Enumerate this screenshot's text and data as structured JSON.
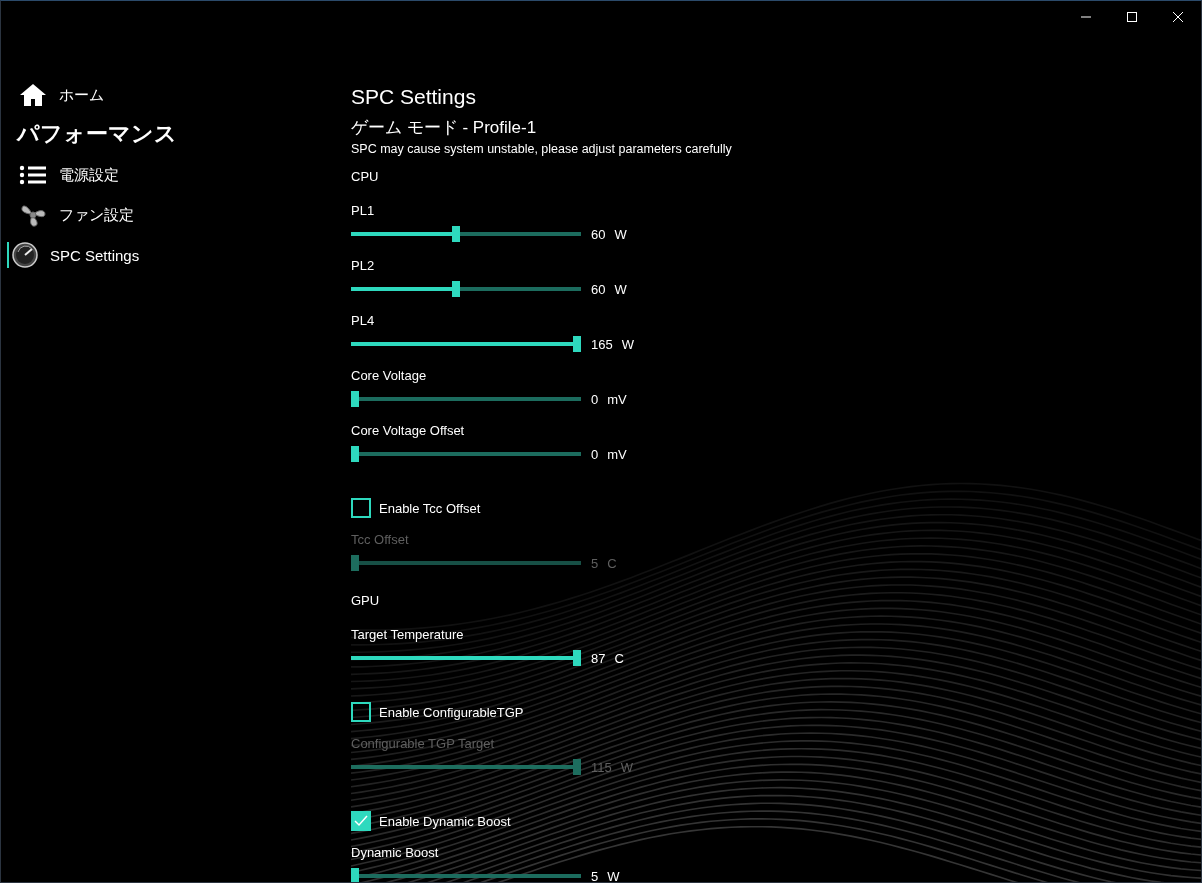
{
  "sidebar": {
    "items": [
      {
        "kind": "home",
        "label": "ホーム",
        "selected": false
      },
      {
        "kind": "header",
        "label": "パフォーマンス"
      },
      {
        "kind": "list",
        "label": "電源設定",
        "selected": false
      },
      {
        "kind": "fan",
        "label": "ファン設定",
        "selected": false
      },
      {
        "kind": "gauge",
        "label": "SPC Settings",
        "selected": true
      }
    ]
  },
  "page": {
    "title": "SPC Settings",
    "subtitle": "ゲーム モード - Profile-1",
    "warning": "SPC may cause system unstable, please adjust parameters carefully",
    "controls": [
      {
        "kind": "heading",
        "label": "CPU"
      },
      {
        "kind": "slider",
        "label": "PL1",
        "level": 0.455,
        "value": "60",
        "unit": "W",
        "disabled": false
      },
      {
        "kind": "slider",
        "label": "PL2",
        "level": 0.455,
        "value": "60",
        "unit": "W",
        "disabled": false
      },
      {
        "kind": "slider",
        "label": "PL4",
        "level": 1,
        "value": "165",
        "unit": "W",
        "disabled": false
      },
      {
        "kind": "slider",
        "label": "Core Voltage",
        "level": 0,
        "value": "0",
        "unit": "mV",
        "disabled": false
      },
      {
        "kind": "slider",
        "label": "Core Voltage Offset",
        "level": 0,
        "value": "0",
        "unit": "mV",
        "disabled": false
      },
      {
        "kind": "checkbox",
        "label": "Enable Tcc Offset",
        "checked": false
      },
      {
        "kind": "slider",
        "label": "Tcc Offset",
        "level": 0,
        "value": "5",
        "unit": "C",
        "disabled": true
      },
      {
        "kind": "heading",
        "label": "GPU"
      },
      {
        "kind": "slider",
        "label": "Target Temperature",
        "level": 1,
        "value": "87",
        "unit": "C",
        "disabled": false
      },
      {
        "kind": "checkbox",
        "label": "Enable ConfigurableTGP",
        "checked": false
      },
      {
        "kind": "slider",
        "label": "Configurable TGP Target",
        "level": 1,
        "value": "115",
        "unit": "W",
        "disabled": true
      },
      {
        "kind": "checkbox",
        "label": "Enable Dynamic Boost",
        "checked": true
      },
      {
        "kind": "slider",
        "label": "Dynamic Boost",
        "level": 0,
        "value": "5",
        "unit": "W",
        "disabled": false
      }
    ]
  }
}
